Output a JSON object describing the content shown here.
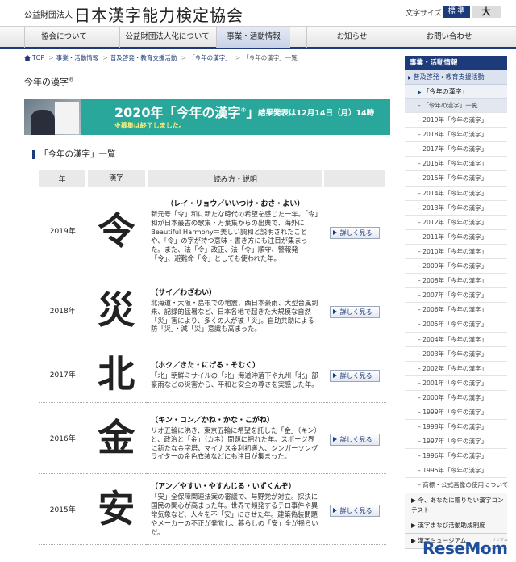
{
  "header": {
    "org_small": "公益財団法人",
    "org_name": "日本漢字能力検定協会",
    "font_size_label": "文字サイズ",
    "font_std": "標 準",
    "font_large": "大"
  },
  "nav": {
    "items": [
      {
        "label": "協会について"
      },
      {
        "label": "公益財団法人化について"
      },
      {
        "label": "事業・活動情報"
      },
      {
        "label": "お知らせ"
      },
      {
        "label": "お問い合わせ"
      }
    ],
    "active_index": 2
  },
  "breadcrumb": {
    "items": [
      "TOP",
      "事業・活動情報",
      "普及啓発・教育支援活動",
      "「今年の漢字」",
      "「今年の漢字」一覧"
    ]
  },
  "page": {
    "title": "今年の漢字",
    "title_mark": "®",
    "section_heading": "「今年の漢字」一覧"
  },
  "banner": {
    "title": "2020年「今年の漢字",
    "title_mark": "®",
    "title_end": "」",
    "note": "※募集は終了しました。",
    "announce": "結果発表は12月14日（月）14時"
  },
  "table": {
    "headers": {
      "year": "年",
      "kanji": "漢字",
      "desc": "読み方・説明"
    },
    "button_label": "詳しく見る",
    "rows": [
      {
        "year": "2019年",
        "kanji": "令",
        "reading": "（レイ・リョウ／いいつけ・おさ・よい）",
        "description": "新元号「令」和に新たな時代の希望を感じた一年。「令」和が日本最古の歌集・万葉集からの出典で、海外にBeautiful Harmony＝美しい調和と説明されたことや、「令」の字が持つ意味・書き方にも注目が集まった。また、法「令」改正、法「令」順守、警報発「令」、避難命「令」としても使われた年。"
      },
      {
        "year": "2018年",
        "kanji": "災",
        "reading": "（サイ／わざわい）",
        "description": "北海道・大阪・島根での地震、西日本豪雨、大型台風到来、記録的猛暑など、日本各地で起きた大規模な自然「災」害により、多くの人が被「災」。自助共助による防「災」・減「災」意識も高まった。"
      },
      {
        "year": "2017年",
        "kanji": "北",
        "reading": "（ホク／きた・にげる・そむく）",
        "description": "「北」朝鮮ミサイルの「北」海道沖落下や九州「北」部豪雨などの災害から、平和と安全の尊さを実感した年。"
      },
      {
        "year": "2016年",
        "kanji": "金",
        "reading": "（キン・コン／かね・かな・こがね）",
        "description": "リオ五輪に沸き、東京五輪に希望を託した「金」（キン）と、政治と「金」（カネ）問題に揺れた年。スポーツ界に新たな金字塔、マイナス金利初導入、シンガーソングライターの金色衣装などにも注目が集まった。"
      },
      {
        "year": "2015年",
        "kanji": "安",
        "reading": "（アン／やすい・やすんじる・いずくんぞ）",
        "description": "「安」全保障関連法案の審議で、与野党が対立。採決に国民の関心が高まった年。世界で頻発するテロ事件や異常気象など、人々を不「安」にさせた年。建築偽装問題やメーカーの不正が発覚し、暮らしの「安」全が揺らいだ。"
      }
    ]
  },
  "sidebar": {
    "header": "事業・活動情報",
    "sub": "普及啓発・教育支援活動",
    "current": "「今年の漢字」",
    "items": [
      "「今年の漢字」一覧",
      "2019年「今年の漢字」",
      "2018年「今年の漢字」",
      "2017年「今年の漢字」",
      "2016年「今年の漢字」",
      "2015年「今年の漢字」",
      "2014年「今年の漢字」",
      "2013年「今年の漢字」",
      "2012年「今年の漢字」",
      "2011年「今年の漢字」",
      "2010年「今年の漢字」",
      "2009年「今年の漢字」",
      "2008年「今年の漢字」",
      "2007年「今年の漢字」",
      "2006年「今年の漢字」",
      "2005年「今年の漢字」",
      "2004年「今年の漢字」",
      "2003年「今年の漢字」",
      "2002年「今年の漢字」",
      "2001年「今年の漢字」",
      "2000年「今年の漢字」",
      "1999年「今年の漢字」",
      "1998年「今年の漢字」",
      "1997年「今年の漢字」",
      "1996年「今年の漢字」",
      "1995年「今年の漢字」",
      "商標・公式画像の使用について"
    ],
    "bottom_items": [
      "今、あなたに贈りたい漢字コンテスト",
      "漢字まなび活動助成制度",
      "漢字ミュージアム"
    ]
  },
  "watermark": {
    "text": "ReseMom",
    "small": "リセマム"
  }
}
